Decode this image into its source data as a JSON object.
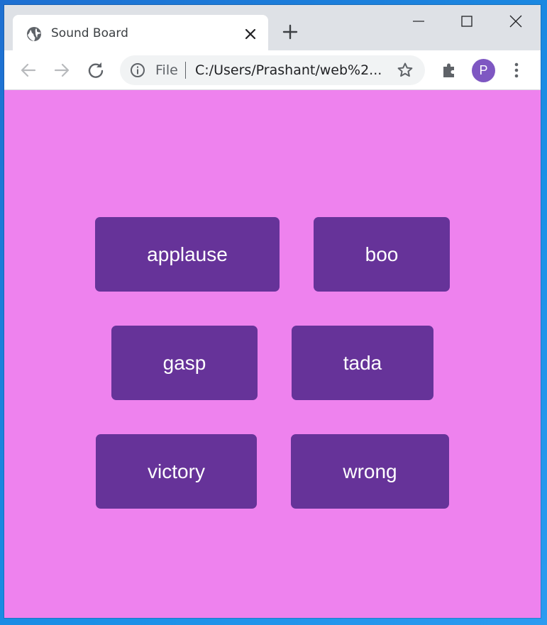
{
  "browser": {
    "tab_title": "Sound Board",
    "omnibox": {
      "scheme_label": "File",
      "url": "C:/Users/Prashant/web%2..."
    },
    "profile_initial": "P",
    "colors": {
      "tabstrip": "#dee1e6",
      "avatar": "#7e57c2"
    }
  },
  "page": {
    "background": "#ee82ee",
    "button_color": "#663399",
    "buttons": [
      {
        "label": "applause"
      },
      {
        "label": "boo"
      },
      {
        "label": "gasp"
      },
      {
        "label": "tada"
      },
      {
        "label": "victory"
      },
      {
        "label": "wrong"
      }
    ]
  },
  "icons": [
    "globe-icon",
    "close-icon",
    "plus-icon",
    "minimize-icon",
    "maximize-icon",
    "window-close-icon",
    "back-arrow-icon",
    "forward-arrow-icon",
    "reload-icon",
    "info-icon",
    "star-icon",
    "extensions-icon",
    "more-vert-icon"
  ]
}
